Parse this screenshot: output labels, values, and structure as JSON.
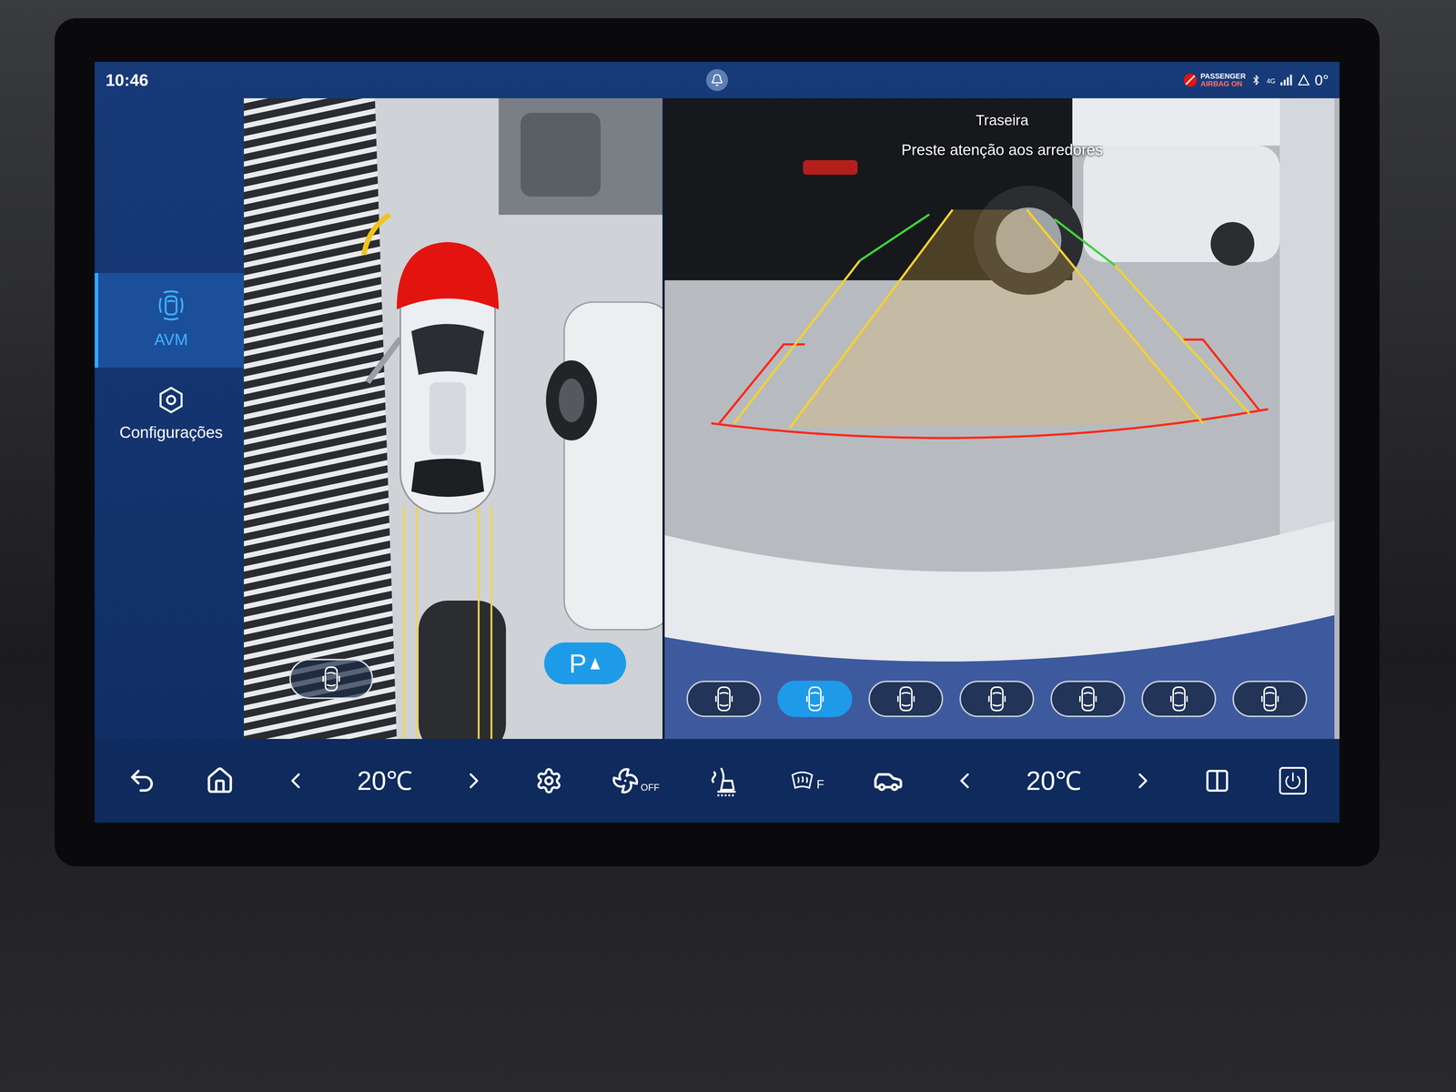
{
  "status_bar": {
    "time": "10:46",
    "airbag": [
      "PASSENGER",
      "AIRBAG ON"
    ],
    "network": "4G",
    "temperature": "0°"
  },
  "sidebar": {
    "items": [
      {
        "label": "AVM",
        "selected": true
      },
      {
        "label": "Configurações",
        "selected": false
      }
    ]
  },
  "surround_view": {
    "parking_button": {
      "label": "P",
      "on": true
    }
  },
  "rear_camera": {
    "title": "Traseira",
    "warning": "Preste atenção aos arredores",
    "views": [
      {
        "selected": false
      },
      {
        "selected": true
      },
      {
        "selected": false
      },
      {
        "selected": false
      },
      {
        "selected": false
      },
      {
        "selected": false
      },
      {
        "selected": false
      }
    ]
  },
  "climate": {
    "left_temp": "20℃",
    "right_temp": "20℃",
    "fan": "OFF",
    "defrost": "F"
  }
}
